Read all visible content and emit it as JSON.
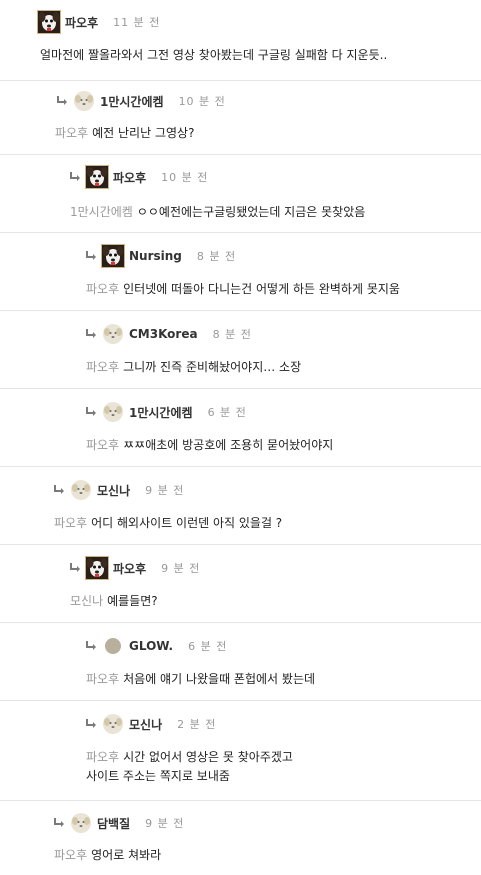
{
  "comments": [
    {
      "nick": "파오후",
      "time": "11 분 전",
      "mention": "",
      "text": "얼마전에 짤올라와서 그전 영상 찾아봤는데 구글링 실패함 다 지운듯..",
      "avatar": "dog-photo-avatar"
    },
    {
      "nick": "1만시간에켐",
      "time": "10 분 전",
      "mention": "파오후",
      "text": "예전 난리난 그영상?",
      "avatar": "puppy-avatar"
    },
    {
      "nick": "파오후",
      "time": "10 분 전",
      "mention": "1만시간에켐",
      "text": "ㅇㅇ예전에는구글링됐었는데 지금은 못찾았음",
      "avatar": "dog-photo-avatar"
    },
    {
      "nick": "Nursing",
      "time": "8 분 전",
      "mention": "파오후",
      "text": "인터넷에 떠돌아 다니는건 어떻게 하든 완벽하게 못지움",
      "avatar": "dog-photo-avatar"
    },
    {
      "nick": "CM3Korea",
      "time": "8 분 전",
      "mention": "파오후",
      "text": "그니까 진즉 준비해놨어야지… 소장",
      "avatar": "puppy-avatar"
    },
    {
      "nick": "1만시간에켐",
      "time": "6 분 전",
      "mention": "파오후",
      "text": "ㅉㅉ애초에 방공호에 조용히 묻어놨어야지",
      "avatar": "puppy-avatar"
    },
    {
      "nick": "모신나",
      "time": "9 분 전",
      "mention": "파오후",
      "text": "어디 해외사이트 이런덴 아직 있을걸 ?",
      "avatar": "puppy-avatar"
    },
    {
      "nick": "파오후",
      "time": "9 분 전",
      "mention": "모신나",
      "text": "예를들면?",
      "avatar": "dog-photo-avatar"
    },
    {
      "nick": "GLOW.",
      "time": "6 분 전",
      "mention": "파오후",
      "text": "처음에 얘기 나왔을때 폰헙에서 봤는데",
      "avatar": "beige-circle-avatar"
    },
    {
      "nick": "모신나",
      "time": "2 분 전",
      "mention": "파오후",
      "text": "시간 없어서 영상은 못 찾아주겠고",
      "text2": "사이트 주소는 쪽지로 보내줌",
      "avatar": "puppy-avatar"
    },
    {
      "nick": "담백질",
      "time": "9 분 전",
      "mention": "파오후",
      "text": "영어로 쳐봐라",
      "avatar": "puppy-avatar"
    }
  ]
}
